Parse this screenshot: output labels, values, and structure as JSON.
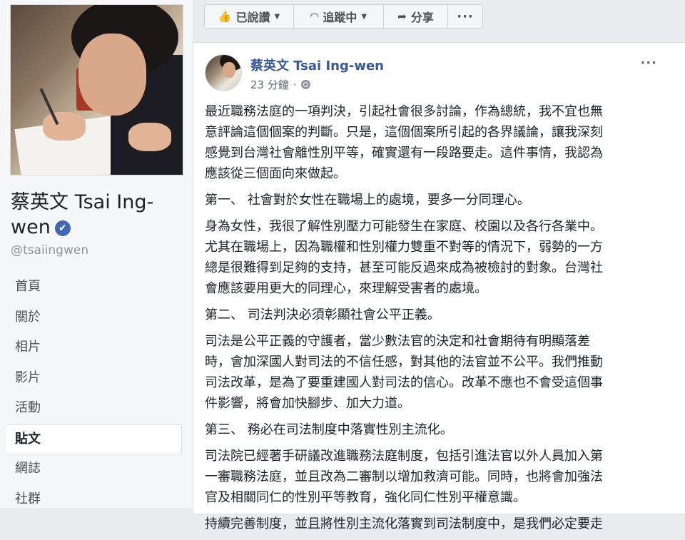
{
  "page": {
    "name": "蔡英文 Tsai Ing-wen",
    "handle": "@tsaiingwen",
    "nav_items": [
      {
        "label": "首頁"
      },
      {
        "label": "關於"
      },
      {
        "label": "相片"
      },
      {
        "label": "影片"
      },
      {
        "label": "活動"
      },
      {
        "label": "貼文",
        "active": true
      },
      {
        "label": "網誌"
      },
      {
        "label": "社群"
      }
    ]
  },
  "actions": {
    "liked_label": "已說讚",
    "following_label": "追蹤中",
    "share_label": "分享",
    "more_label": "···"
  },
  "post": {
    "author": "蔡英文 Tsai Ing-wen",
    "time": "23 分鐘",
    "menu_label": "···",
    "paragraphs": [
      "最近職務法庭的一項判決，引起社會很多討論，作為總統，我不宜也無\n意評論這個個案的判斷。只是，這個個案所引起的各界議論，讓我深刻\n感覺到台灣社會離性別平等，確實還有一段路要走。這件事情，我認為\n應該從三個面向來做起。",
      "第一、 社會對於女性在職場上的處境，要多一分同理心。",
      "身為女性，我很了解性別壓力可能發生在家庭、校園以及各行各業中。\n尤其在職場上，因為職權和性別權力雙重不對等的情況下，弱勢的一方\n總是很難得到足夠的支持，甚至可能反過來成為被檢討的對象。台灣社\n會應該要用更大的同理心，來理解受害者的處境。",
      "第二、 司法判決必須彰顯社會公平正義。",
      "司法是公平正義的守護者，當少數法官的決定和社會期待有明顯落差\n時，會加深國人對司法的不信任感，對其他的法官並不公平。我們推動\n司法改革，是為了要重建國人對司法的信心。改革不應也不會受這個事\n件影響，將會加快腳步、加大力道。",
      "第三、 務必在司法制度中落實性別主流化。",
      "司法院已經著手研議改進職務法庭制度，包括引進法官以外人員加入第\n一審職務法庭，並且改為二審制以增加救濟可能。同時，也將會加強法\n官及相關同仁的性別平等教育，強化同仁性別平權意識。",
      "持續完善制度，並且將性別主流化落實到司法制度中，是我們必定要走"
    ]
  },
  "colors": {
    "brand_link": "#385898",
    "verified_badge": "#4267b2"
  }
}
